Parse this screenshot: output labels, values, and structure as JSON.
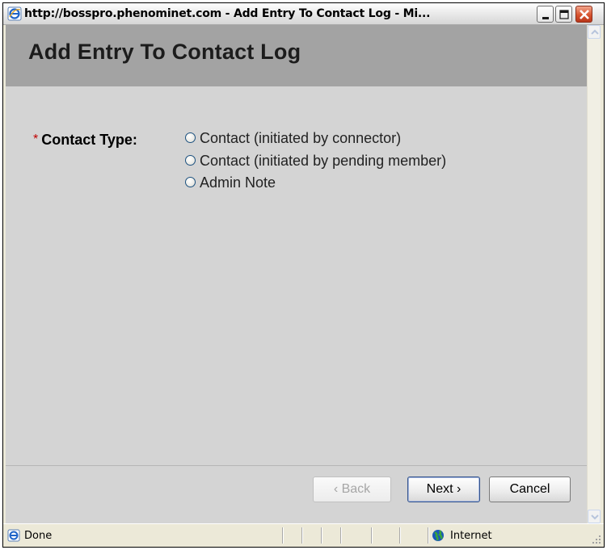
{
  "window": {
    "title": "http://bosspro.phenominet.com - Add Entry To Contact Log - Mi..."
  },
  "page": {
    "title": "Add Entry To Contact Log"
  },
  "form": {
    "required_mark": "*",
    "contact_type_label": "Contact Type:",
    "options": [
      {
        "label": "Contact (initiated by connector)",
        "selected": false
      },
      {
        "label": "Contact (initiated by pending member)",
        "selected": false
      },
      {
        "label": "Admin Note",
        "selected": false
      }
    ]
  },
  "buttons": {
    "back": "‹ Back",
    "next": "Next ›",
    "cancel": "Cancel"
  },
  "statusbar": {
    "status": "Done",
    "zone": "Internet"
  },
  "colors": {
    "header_bg": "#a3a3a3",
    "content_bg": "#d4d4d4",
    "required": "#c00000"
  }
}
